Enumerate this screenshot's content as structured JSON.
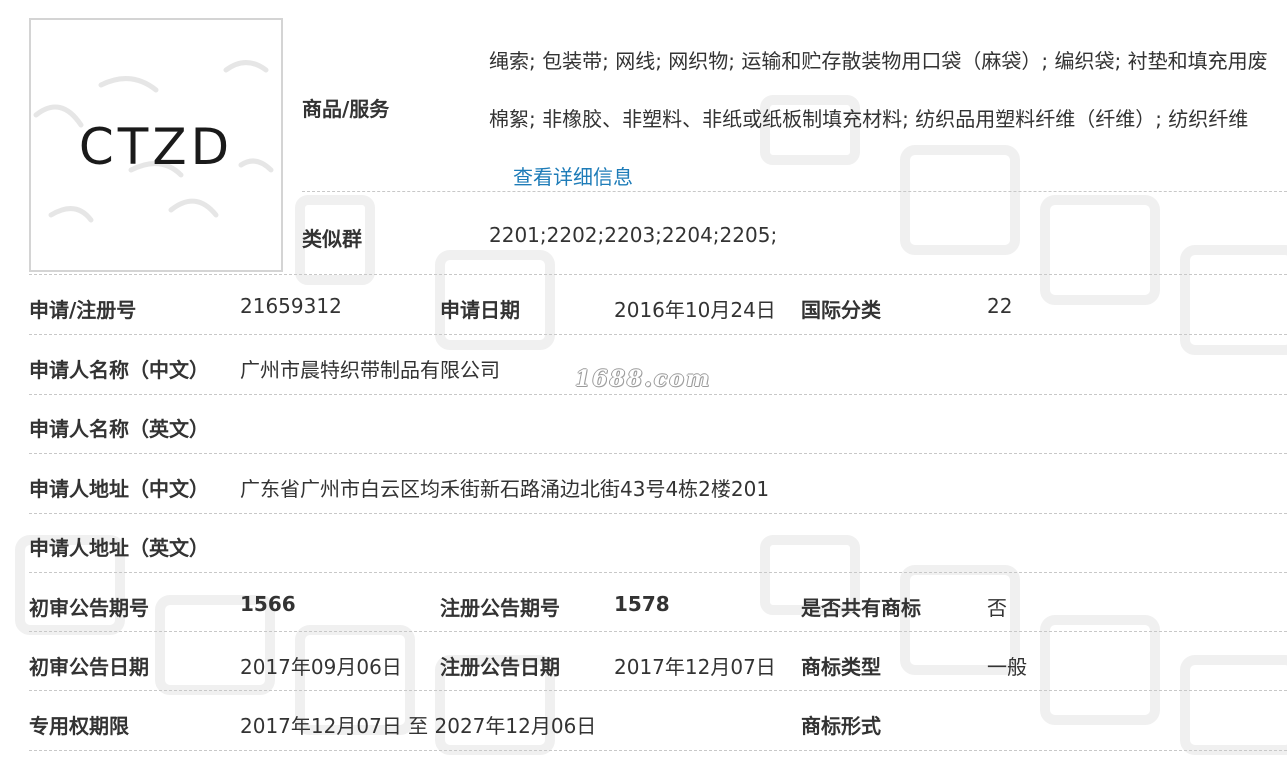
{
  "logo": {
    "text": "CTZD"
  },
  "watermark": {
    "site": "1688.com"
  },
  "goods": {
    "label": "商品/服务",
    "text": "绳索; 包装带; 网线; 网织物; 运输和贮存散装物用口袋（麻袋）; 编织袋; 衬垫和填充用废棉絮; 非橡胶、非塑料、非纸或纸板制填充材料; 纺织品用塑料纤维（纤维）; 纺织纤维",
    "link": "查看详细信息"
  },
  "similar": {
    "label": "类似群",
    "value": "2201;2202;2203;2204;2205;"
  },
  "rows": {
    "reg_no": {
      "label": "申请/注册号",
      "value": "21659312"
    },
    "app_date": {
      "label": "申请日期",
      "value": "2016年10月24日"
    },
    "intl_class": {
      "label": "国际分类",
      "value": "22"
    },
    "applicant_cn": {
      "label": "申请人名称（中文）",
      "value": "广州市晨特织带制品有限公司"
    },
    "applicant_en": {
      "label": "申请人名称（英文）",
      "value": ""
    },
    "address_cn": {
      "label": "申请人地址（中文）",
      "value": "广东省广州市白云区均禾街新石路涌边北街43号4栋2楼201"
    },
    "address_en": {
      "label": "申请人地址（英文）",
      "value": ""
    },
    "prelim_issue": {
      "label": "初审公告期号",
      "value": "1566"
    },
    "reg_issue": {
      "label": "注册公告期号",
      "value": "1578"
    },
    "shared": {
      "label": "是否共有商标",
      "value": "否"
    },
    "prelim_date": {
      "label": "初审公告日期",
      "value": "2017年09月06日"
    },
    "reg_date": {
      "label": "注册公告日期",
      "value": "2017年12月07日"
    },
    "tm_type": {
      "label": "商标类型",
      "value": "一般"
    },
    "term": {
      "label": "专用权期限",
      "value": "2017年12月07日 至 2027年12月06日"
    },
    "tm_form": {
      "label": "商标形式",
      "value": ""
    }
  }
}
